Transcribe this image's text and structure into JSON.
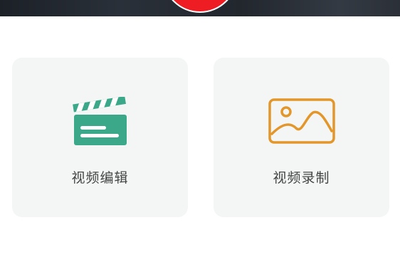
{
  "header": {
    "record_icon": "record-button-icon",
    "accent_color": "#ee1d23"
  },
  "cards": [
    {
      "label": "视频编辑",
      "icon": "clapperboard-icon",
      "icon_color": "#3aa889"
    },
    {
      "label": "视频录制",
      "icon": "image-icon",
      "icon_color": "#e3962a"
    }
  ]
}
